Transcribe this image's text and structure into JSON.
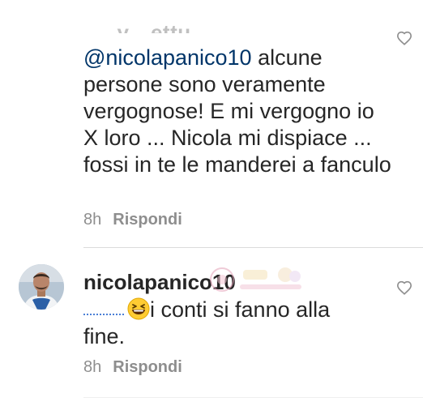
{
  "comment_1": {
    "username_partial": "…y…ettu_…",
    "mention": "@nicolapanico10",
    "text": " alcune persone sono veramente vergognose! E mi vergogno io X loro ... Nicola mi dispiace ... fossi in te le manderei a fanculo",
    "time": "8h",
    "reply_label": "Rispondi",
    "like_icon": "heart-outline-icon"
  },
  "comment_2": {
    "username": "nicolapanico10",
    "text_part1": "i conti si fanno alla",
    "text_part2": "fine.",
    "emoji": "grinning-squinting-face",
    "time": "8h",
    "reply_label": "Rispondi",
    "like_icon": "heart-outline-icon",
    "avatar_icon": "user-avatar-photo"
  },
  "colors": {
    "text": "#262626",
    "secondary": "#8e8e8e",
    "mention": "#003569",
    "divider": "#dbdbdb"
  }
}
